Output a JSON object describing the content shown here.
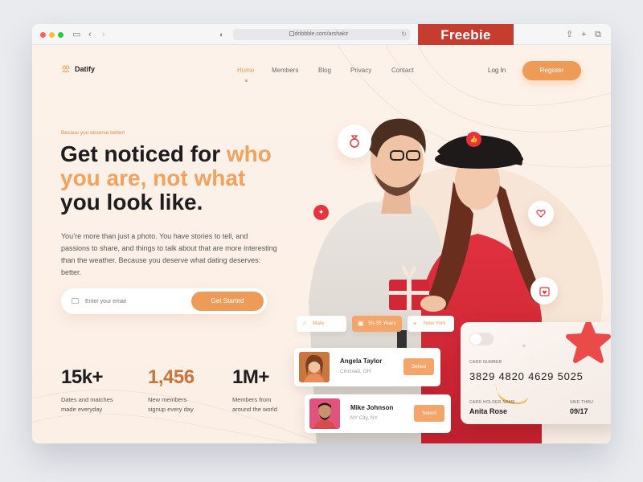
{
  "browser": {
    "url": "dribbble.com/arshakir",
    "freebie": "Freebie",
    "traffic_lights": [
      "#fe5f57",
      "#febc2e",
      "#28c840"
    ]
  },
  "brand": {
    "name": "Datify",
    "accent": "#ee9b57"
  },
  "nav": {
    "items": [
      {
        "label": "Home",
        "active": true
      },
      {
        "label": "Members",
        "active": false
      },
      {
        "label": "Blog",
        "active": false
      },
      {
        "label": "Privacy",
        "active": false
      },
      {
        "label": "Contact",
        "active": false
      }
    ],
    "login": "Log In",
    "register": "Register"
  },
  "hero": {
    "eyebrow": "Becaue you deserve better!",
    "headline_1": "Get noticed for ",
    "headline_2": "who you are, ",
    "headline_3": "not what",
    "headline_4": "you look like.",
    "paragraph": "You’re more than just a photo. You have stories to tell, and passions to share, and things to talk about that are more interesting than the weather. Because you deserve what dating deserves: better.",
    "email_placeholder": "Enter your email",
    "cta": "Get Started"
  },
  "stats": [
    {
      "value": "15k+",
      "label": "Dates and matches made everyday"
    },
    {
      "value": "1,456",
      "label": "New members signup every day"
    },
    {
      "value": "1M+",
      "label": "Members from around the world"
    }
  ],
  "filters": [
    {
      "label": "Male",
      "icon": "male-icon",
      "selected": false
    },
    {
      "label": "30-35 Years",
      "icon": "calendar-icon",
      "selected": true
    },
    {
      "label": "New York",
      "icon": "location-pin-icon",
      "selected": false
    }
  ],
  "profiles": [
    {
      "name": "Angela Taylor",
      "location": "Cincinati, OH",
      "action": "Select"
    },
    {
      "name": "Mike Johnson",
      "location": "NY City, NY",
      "action": "Select"
    }
  ],
  "card": {
    "number_label": "CARD NUMBER",
    "number": "3829 4820 4629 5025",
    "holder_label": "CARD HOLDER NAME",
    "holder": "Anita Rose",
    "valid_label": "VAID THRU",
    "valid": "09/17"
  }
}
